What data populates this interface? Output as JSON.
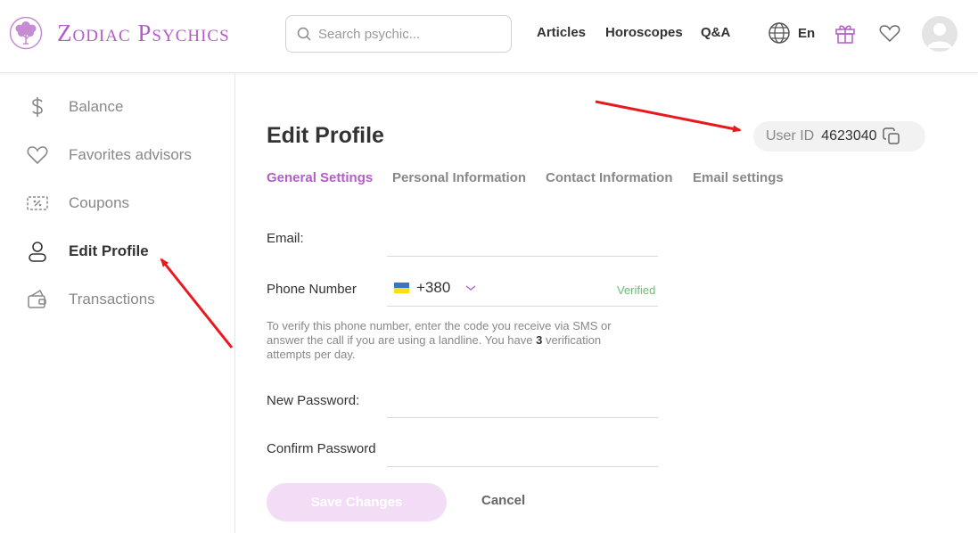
{
  "header": {
    "logo_text": "Zodiac Psychics",
    "search_placeholder": "Search psychic...",
    "nav": [
      "Articles",
      "Horoscopes",
      "Q&A"
    ],
    "language": "En",
    "icons": [
      "globe-icon",
      "gift-icon",
      "heart-icon",
      "avatar-icon"
    ]
  },
  "sidebar": {
    "items": [
      {
        "label": "Balance",
        "icon": "dollar-icon"
      },
      {
        "label": "Favorites advisors",
        "icon": "heart-icon"
      },
      {
        "label": "Coupons",
        "icon": "coupon-icon"
      },
      {
        "label": "Edit Profile",
        "icon": "user-icon",
        "active": true
      },
      {
        "label": "Transactions",
        "icon": "wallet-icon"
      }
    ]
  },
  "main": {
    "title": "Edit Profile",
    "user_id_label": "User ID",
    "user_id_value": "4623040",
    "tabs": [
      {
        "label": "General Settings",
        "active": true
      },
      {
        "label": "Personal Information"
      },
      {
        "label": "Contact Information"
      },
      {
        "label": "Email settings"
      }
    ],
    "form": {
      "email_label": "Email:",
      "email_value": "",
      "phone_label": "Phone Number",
      "phone_code": "+380",
      "phone_value": "",
      "verified_text": "Verified",
      "hint_text_before": "To verify this phone number, enter the code you receive via SMS or answer the call if you are using a landline. You have ",
      "hint_attempts": "3",
      "hint_text_after": " verification attempts per day.",
      "new_password_label": "New Password:",
      "confirm_password_label": "Confirm Password",
      "save_label": "Save Changes",
      "cancel_label": "Cancel"
    }
  },
  "colors": {
    "brand": "#b45cc8",
    "verified": "#67c16d",
    "save_button_bg": "#f3dcf5",
    "annotation_arrow": "#e8191e"
  }
}
